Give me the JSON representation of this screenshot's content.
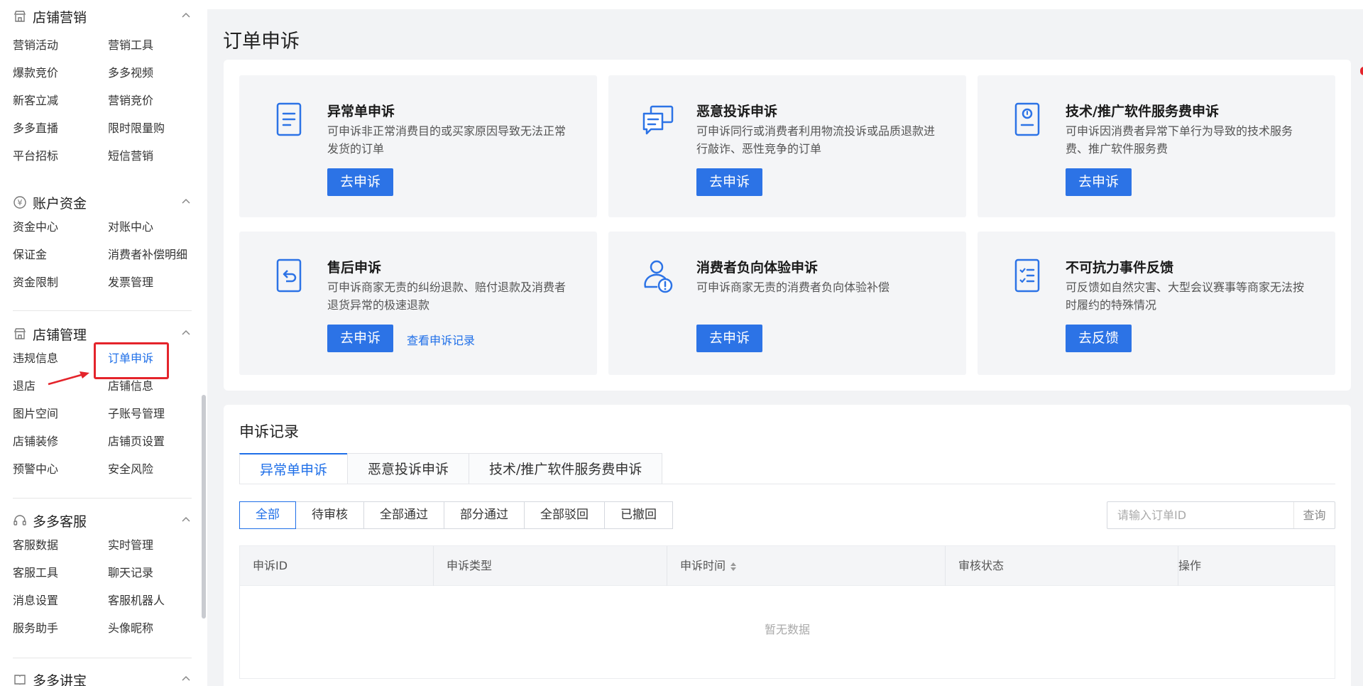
{
  "sidebar": {
    "sections": [
      {
        "title": "店铺营销",
        "icon": "store-icon",
        "items": [
          "营销活动",
          "营销工具",
          "爆款竞价",
          "多多视频",
          "新客立减",
          "营销竞价",
          "多多直播",
          "限时限量购",
          "平台招标",
          "短信营销"
        ]
      },
      {
        "title": "账户资金",
        "icon": "yen-icon",
        "items": [
          "资金中心",
          "对账中心",
          "保证金",
          "消费者补偿明细",
          "资金限制",
          "发票管理"
        ]
      },
      {
        "title": "店铺管理",
        "icon": "store-icon",
        "items": [
          "违规信息",
          "订单申诉",
          "退店",
          "店铺信息",
          "图片空间",
          "子账号管理",
          "店铺装修",
          "店铺页设置",
          "预警中心",
          "安全风险"
        ]
      },
      {
        "title": "多多客服",
        "icon": "headset-icon",
        "items": [
          "客服数据",
          "实时管理",
          "客服工具",
          "聊天记录",
          "消息设置",
          "客服机器人",
          "服务助手",
          "头像昵称"
        ]
      },
      {
        "title": "多多讲宝",
        "icon": "book-icon",
        "items": []
      }
    ],
    "active_item": "订单申诉"
  },
  "page": {
    "title": "订单申诉"
  },
  "tiles": [
    {
      "title": "异常单申诉",
      "desc": "可申诉非正常消费目的或买家原因导致无法正常发货的订单",
      "button": "去申诉",
      "icon": "document-icon"
    },
    {
      "title": "恶意投诉申诉",
      "desc": "可申诉同行或消费者利用物流投诉或品质退款进行敲诈、恶性竞争的订单",
      "button": "去申诉",
      "icon": "messages-icon"
    },
    {
      "title": "技术/推广软件服务费申诉",
      "desc": "可申诉因消费者异常下单行为导致的技术服务费、推广软件服务费",
      "button": "去申诉",
      "icon": "alert-document-icon"
    },
    {
      "title": "售后申诉",
      "desc": "可申诉商家无责的纠纷退款、赔付退款及消费者退货异常的极速退款",
      "button": "去申诉",
      "link": "查看申诉记录",
      "icon": "return-icon"
    },
    {
      "title": "消费者负向体验申诉",
      "desc": "可申诉商家无责的消费者负向体验补偿",
      "button": "去申诉",
      "icon": "user-alert-icon"
    },
    {
      "title": "不可抗力事件反馈",
      "desc": "可反馈如自然灾害、大型会议赛事等商家无法按时履约的特殊情况",
      "button": "去反馈",
      "icon": "checklist-icon"
    }
  ],
  "records": {
    "title": "申诉记录",
    "tabs": [
      "异常单申诉",
      "恶意投诉申诉",
      "技术/推广软件服务费申诉"
    ],
    "filters": [
      "全部",
      "待审核",
      "全部通过",
      "部分通过",
      "全部驳回",
      "已撤回"
    ],
    "search": {
      "placeholder": "请输入订单ID",
      "button": "查询"
    },
    "columns": [
      "申诉ID",
      "申诉类型",
      "申诉时间",
      "审核状态",
      "操作"
    ],
    "empty_text": "暂无数据"
  },
  "colors": {
    "accent": "#2c73e6",
    "annotation": "#e4242b"
  }
}
